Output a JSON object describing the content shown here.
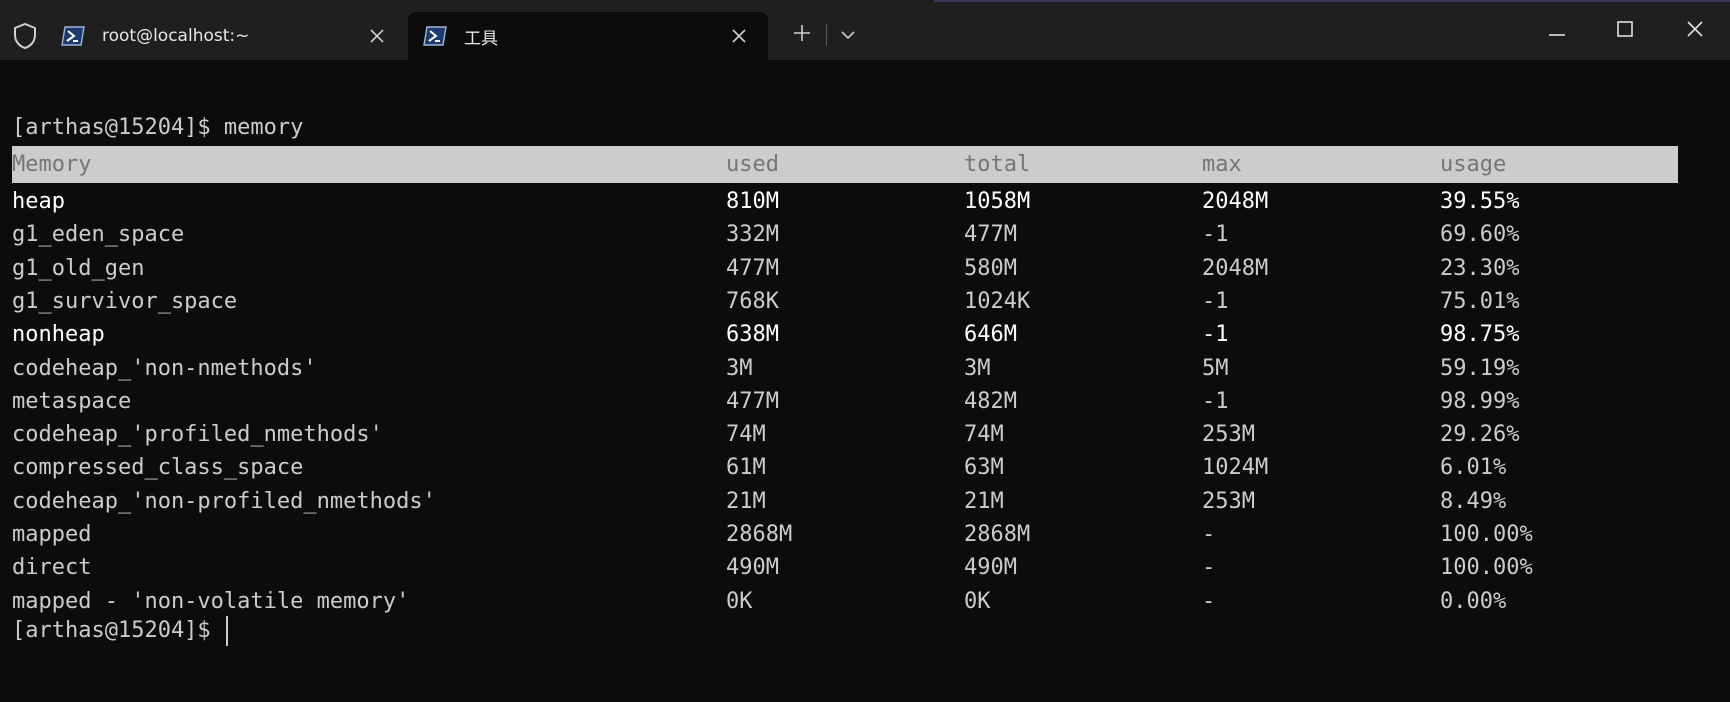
{
  "tabs": [
    {
      "label": "root@localhost:~",
      "active": false
    },
    {
      "label": "工具",
      "active": true
    }
  ],
  "icons": {
    "shield": "shield-icon",
    "tab": "powershell-icon",
    "close": "close-icon",
    "new_tab": "plus-icon",
    "dropdown": "chevron-down-icon",
    "minimize": "minimize-icon",
    "maximize": "maximize-icon",
    "window_close": "close-icon"
  },
  "colors": {
    "background": "#0c0c0c",
    "text": "#cccccc",
    "bright_text": "#ffffff",
    "header_bg": "#cccccc",
    "header_text": "#767676",
    "tabbar": "#1f1f1f"
  },
  "terminal": {
    "command_line": "[arthas@15204]$ memory",
    "prompt": "[arthas@15204]$ ",
    "headers": [
      "Memory",
      "used",
      "total",
      "max",
      "usage"
    ],
    "rows": [
      {
        "cells": [
          "heap",
          "810M",
          "1058M",
          "2048M",
          "39.55%"
        ],
        "bold": true
      },
      {
        "cells": [
          "g1_eden_space",
          "332M",
          "477M",
          "-1",
          "69.60%"
        ],
        "bold": false
      },
      {
        "cells": [
          "g1_old_gen",
          "477M",
          "580M",
          "2048M",
          "23.30%"
        ],
        "bold": false
      },
      {
        "cells": [
          "g1_survivor_space",
          "768K",
          "1024K",
          "-1",
          "75.01%"
        ],
        "bold": false
      },
      {
        "cells": [
          "nonheap",
          "638M",
          "646M",
          "-1",
          "98.75%"
        ],
        "bold": true
      },
      {
        "cells": [
          "codeheap_'non-nmethods'",
          "3M",
          "3M",
          "5M",
          "59.19%"
        ],
        "bold": false
      },
      {
        "cells": [
          "metaspace",
          "477M",
          "482M",
          "-1",
          "98.99%"
        ],
        "bold": false
      },
      {
        "cells": [
          "codeheap_'profiled_nmethods'",
          "74M",
          "74M",
          "253M",
          "29.26%"
        ],
        "bold": false
      },
      {
        "cells": [
          "compressed_class_space",
          "61M",
          "63M",
          "1024M",
          "6.01%"
        ],
        "bold": false
      },
      {
        "cells": [
          "codeheap_'non-profiled_nmethods'",
          "21M",
          "21M",
          "253M",
          "8.49%"
        ],
        "bold": false
      },
      {
        "cells": [
          "mapped",
          "2868M",
          "2868M",
          "-",
          "100.00%"
        ],
        "bold": false
      },
      {
        "cells": [
          "direct",
          "490M",
          "490M",
          "-",
          "100.00%"
        ],
        "bold": false
      },
      {
        "cells": [
          "mapped - 'non-volatile memory'",
          "0K",
          "0K",
          "-",
          "0.00%"
        ],
        "bold": false
      }
    ]
  }
}
